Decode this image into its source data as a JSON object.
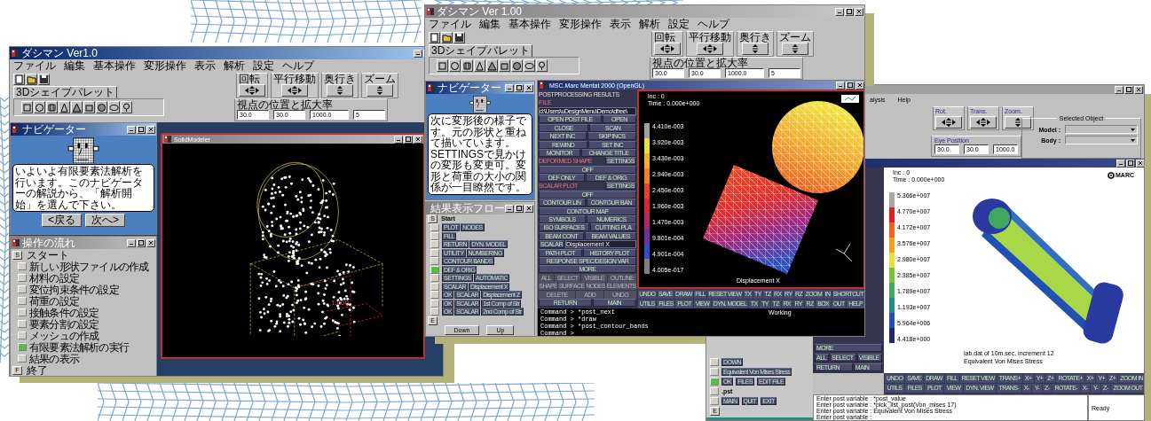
{
  "left_window": {
    "title": "ダシマン Ver1.0",
    "menu": [
      "ファイル",
      "編集",
      "基本操作",
      "変形操作",
      "表示",
      "解析",
      "設定",
      "ヘルプ"
    ],
    "palette_tab": "3Dシェイプパレット",
    "view_groups": [
      "回転",
      "平行移動",
      "奥行き",
      "ズーム"
    ],
    "view_settings": {
      "label": "視点の位置と拡大率",
      "values": [
        "30.0",
        "30.0",
        "1000.0",
        "5"
      ]
    },
    "navigator": {
      "title": "ナビゲーター",
      "message": "いよいよ有限要素法解析を行います。このナビゲーターの解説から、「解析開始」を選んで下さい。",
      "buttons": [
        "<戻る",
        "次へ>"
      ]
    },
    "flow": {
      "title": "操作の流れ",
      "start_marker": "S",
      "start": "スタート",
      "end_marker": "F",
      "end": "終了",
      "steps": [
        {
          "label": "新しい形状ファイルの作成",
          "selected": false
        },
        {
          "label": "材料の設定",
          "selected": false
        },
        {
          "label": "変位拘束条件の設定",
          "selected": false
        },
        {
          "label": "荷重の設定",
          "selected": false
        },
        {
          "label": "接触条件の設定",
          "selected": false
        },
        {
          "label": "要素分割の設定",
          "selected": false
        },
        {
          "label": "メッシュの作成",
          "selected": false
        },
        {
          "label": "有限要素法解析の実行",
          "selected": true
        },
        {
          "label": "結果の表示",
          "selected": false
        }
      ]
    },
    "viewer": {
      "title": "SolidModeler",
      "dimension_label": "1.000"
    }
  },
  "middle_window": {
    "title": "ダシマン Ver 1.00",
    "menu": [
      "ファイル",
      "編集",
      "基本操作",
      "変形操作",
      "表示",
      "解析",
      "設定",
      "ヘルプ"
    ],
    "palette_tab": "3Dシェイプパレット",
    "view_groups": [
      "回転",
      "平行移動",
      "奥行き",
      "ズーム"
    ],
    "view_settings": {
      "label": "視点の位置と拡大率",
      "values": [
        "30.0",
        "30.0",
        "1000.0",
        "5"
      ]
    },
    "navigator": {
      "title": "ナビゲーター",
      "message": "次に変形後の様子です。元の形状と重ねて描いています。SETTINGSで見かけの変形も変更可。変形と荷重の大小の関係が一目瞭然です。"
    },
    "flow": {
      "title": "結果表示フロー",
      "start_marker": "S",
      "start": "Start",
      "end_marker": "E",
      "buttons": [
        "Down",
        "Up"
      ],
      "steps": [
        {
          "buttons": [
            "PLOT",
            "NODES"
          ],
          "selected": false
        },
        {
          "buttons": [
            "FILL"
          ],
          "selected": false
        },
        {
          "buttons": [
            "RETURN",
            "DYN. MODEL"
          ],
          "selected": false
        },
        {
          "buttons": [
            "UTILITY",
            "NUMBERING"
          ],
          "selected": false
        },
        {
          "buttons": [
            "CONTOUR BANDS"
          ],
          "selected": false
        },
        {
          "buttons": [
            "DEF & ORIG"
          ],
          "selected": true
        },
        {
          "buttons": [
            "SETTINGS",
            "AUTOMATIC"
          ],
          "selected": false
        },
        {
          "buttons": [
            "SCALAR",
            "Displacement X"
          ],
          "selected": false
        },
        {
          "buttons": [
            "OK",
            "SCALAR",
            "Displacement Z"
          ],
          "selected": false
        },
        {
          "buttons": [
            "OK",
            "SCALAR",
            "1st Comp of Str"
          ],
          "selected": false
        },
        {
          "buttons": [
            "OK",
            "SCALAR",
            "2nd Comp of Str"
          ],
          "selected": false
        }
      ]
    },
    "mentat": {
      "title": "MSC.Marc Mentat 2000 (OpenGL)",
      "panel": [
        {
          "kind": "title",
          "text": "POSTPROCESSING RESULTS"
        },
        {
          "kind": "header",
          "text": "FILE"
        },
        {
          "kind": "field",
          "text": "d:\\Users\\uDesignMenu\\Demo\\dfree\\"
        },
        {
          "kind": "buttons",
          "items": [
            "OPEN POST FILE",
            "OPEN"
          ]
        },
        {
          "kind": "buttons",
          "items": [
            "CLOSE",
            "SCAN"
          ]
        },
        {
          "kind": "buttons",
          "items": [
            "NEXT INC",
            "SKIP INCS"
          ]
        },
        {
          "kind": "buttons",
          "items": [
            "REWIND",
            "SET INC"
          ]
        },
        {
          "kind": "buttons",
          "items": [
            "MONITOR",
            "CHANGE TITLE"
          ]
        },
        {
          "kind": "header_button",
          "text": "DEFORMED SHAPE",
          "button": "SETTINGS"
        },
        {
          "kind": "buttons",
          "items": [
            "OFF"
          ]
        },
        {
          "kind": "buttons",
          "items": [
            "DEF ONLY",
            "DEF & ORIG"
          ]
        },
        {
          "kind": "header_button",
          "text": "SCALAR PLOT",
          "button": "SETTINGS"
        },
        {
          "kind": "buttons",
          "items": [
            "OFF"
          ]
        },
        {
          "kind": "buttons",
          "items": [
            "CONTOUR LIN",
            "CONTOUR BAN"
          ]
        },
        {
          "kind": "buttons",
          "items": [
            "CONTOUR MAP"
          ]
        },
        {
          "kind": "buttons",
          "items": [
            "SYMBOLS",
            "NUMERICS"
          ]
        },
        {
          "kind": "buttons",
          "items": [
            "ISO SURFACES",
            "CUTTING PLA"
          ]
        },
        {
          "kind": "buttons",
          "items": [
            "BEAM CONT",
            "BEAM VALUES"
          ]
        },
        {
          "kind": "select",
          "label": "SCALAR",
          "value": "Displacement X"
        },
        {
          "kind": "buttons",
          "items": [
            "PATH PLOT",
            "HISTORY PLOT"
          ]
        },
        {
          "kind": "buttons",
          "items": [
            "RESPONSE SPEC/DESIGN VAR"
          ]
        },
        {
          "kind": "buttons",
          "items": [
            "MORE"
          ]
        },
        {
          "kind": "dim",
          "items": [
            "ALL",
            "SELECT",
            "VISIBLE",
            "OUTLINE"
          ]
        },
        {
          "kind": "dim",
          "items": [
            "SHAPE",
            "SURFACE",
            "NODES",
            "ELEMENTS"
          ]
        },
        {
          "kind": "dim",
          "items": [
            "DELETE",
            "ADD",
            "UNDO"
          ]
        },
        {
          "kind": "buttons",
          "items": [
            "RETURN",
            "MAIN"
          ]
        }
      ],
      "viewport": {
        "inc": "inc : 0",
        "time": "Time : 0.000e+000",
        "legend": [
          "4.410e-003",
          "3.920e-003",
          "3.430e-003",
          "2.940e-003",
          "2.450e-003",
          "1.960e-003",
          "1.470e-003",
          "9.801e-004",
          "4.901e-004",
          "4.005e-017"
        ],
        "variable": "Displacement X"
      },
      "toolbar_rows": [
        [
          "UNDO",
          "SAVE",
          "DRAW",
          "FILL",
          "RESET VIEW",
          "TX",
          "TY",
          "TZ",
          "RX",
          "RY",
          "RZ",
          "ZOOM",
          "IN",
          "SHORTCUT"
        ],
        [
          "UTILS",
          "FILES",
          "PLOT",
          "VIEW",
          "DYN. MODEL",
          "TX",
          "TY",
          "TZ",
          "RX",
          "RY",
          "RZ",
          "BOX",
          "OUT",
          "HELP"
        ]
      ],
      "status": "Working",
      "commands": [
        "Command > *post_next",
        "Command > *draw",
        "Command > *post_contour_bands",
        "Command >"
      ]
    }
  },
  "right_window": {
    "menu": [
      "alysis",
      "Help"
    ],
    "view_groups": [
      "Rot.",
      "Trans.",
      "Zoom."
    ],
    "eye_position": {
      "label": "Eye Position",
      "values": [
        "30.0",
        "30.0",
        "1000.0"
      ]
    },
    "selected_object": {
      "title": "Selected Object",
      "fields": [
        "Model :",
        "Body :"
      ]
    },
    "flow": {
      "end_marker": "E",
      "steps": [
        {
          "kind": "buttons",
          "items": [
            "DOWN"
          ],
          "selected": false
        },
        {
          "kind": "buttons",
          "items": [
            "Equivalent Von Mises Stress"
          ],
          "selected": false
        },
        {
          "kind": "buttons",
          "items": [
            "OK",
            "FILES",
            "EDIT FILE"
          ],
          "selected": true
        },
        {
          "kind": "text",
          "items": [
            ".pst"
          ],
          "selected": false
        },
        {
          "kind": "buttons",
          "items": [
            "MAIN",
            "QUIT",
            "EXIT"
          ],
          "selected": false
        }
      ]
    },
    "mentat": {
      "panel": [
        [
          "MORE"
        ],
        [
          "ALL",
          "SELECT",
          "VISIBLE"
        ],
        [
          "RETURN",
          "MAIN"
        ]
      ],
      "viewport": {
        "inc": "Inc : 0",
        "time": "Time : 0.000e+000",
        "logo": "MARC",
        "legend": [
          "5.366e+007",
          "4.770e+007",
          "4.172e+007",
          "3.576e+007",
          "2.980e+007",
          "2.385e+007",
          "1.789e+007",
          "1.193e+007",
          "5.964e+006",
          "4.418e+000"
        ],
        "caption": [
          "lab.dat of 10m.sec, increment 12",
          "Equivalent Von Mises Stress"
        ]
      },
      "toolbar_rows": [
        [
          "UNDO",
          "SAVE",
          "DRAW",
          "FILL",
          "RESET VIEW",
          "TRANS+",
          "X+",
          "Y+",
          "Z+",
          "ROTATE+",
          "X+",
          "Y+",
          "Z+",
          "ZOOM IN"
        ],
        [
          "UTILS",
          "FILES",
          "PLOT",
          "VIEW",
          "DYN. VIEW",
          "TRANS-",
          "X-",
          "Y-",
          "Z-",
          "ROTATE-",
          "X-",
          "Y-",
          "Z-",
          "ZOOM OUT"
        ]
      ],
      "log": [
        "Enter post variable : *post_value",
        "Enter post variable : *pick_list_post(Von_mises 17)",
        "Enter post variable : Equivalent Von Mises Stress",
        "Enter post variable :"
      ],
      "status": "Ready"
    }
  }
}
